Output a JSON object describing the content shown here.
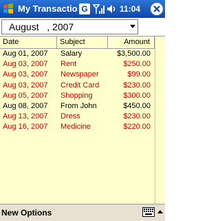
{
  "titlebar": {
    "app_title": "My Transaction",
    "g_label": "G",
    "time": "11:04",
    "icons": [
      "start-logo-icon",
      "signal-icon",
      "volume-icon",
      "close-icon"
    ]
  },
  "date_select": {
    "value": "August   , 2007"
  },
  "table": {
    "columns": [
      "Date",
      "Subject",
      "Amount"
    ],
    "rows": [
      {
        "date": "Aug 01, 2007",
        "subject": "Salary",
        "amount": "$3,500.00",
        "color": "#000000"
      },
      {
        "date": "Aug 03, 2007",
        "subject": "Rent",
        "amount": "$250.00",
        "color": "#cc0000"
      },
      {
        "date": "Aug 03, 2007",
        "subject": "Newspaper",
        "amount": "$99.00",
        "color": "#cc0000"
      },
      {
        "date": "Aug 03, 2007",
        "subject": "Credit Card",
        "amount": "$230.00",
        "color": "#cc0000"
      },
      {
        "date": "Aug 05, 2007",
        "subject": "Shopping",
        "amount": "$300.00",
        "color": "#cc0000"
      },
      {
        "date": "Aug 08, 2007",
        "subject": "From John",
        "amount": "$450.00",
        "color": "#000000"
      },
      {
        "date": "Aug 13, 2007",
        "subject": "Dress",
        "amount": "$230.00",
        "color": "#cc0000"
      },
      {
        "date": "Aug 16, 2007",
        "subject": "Medicine",
        "amount": "$220.00",
        "color": "#cc0000"
      }
    ]
  },
  "menubar": {
    "left_label": "New Options",
    "icons": [
      "keyboard-icon",
      "menu-up-arrow-icon"
    ]
  },
  "colors": {
    "titlebar": "#0c47a8",
    "table_background": "#ffffcc",
    "expense": "#cc0000",
    "income": "#000000",
    "menubar": "#e8e1d2"
  }
}
